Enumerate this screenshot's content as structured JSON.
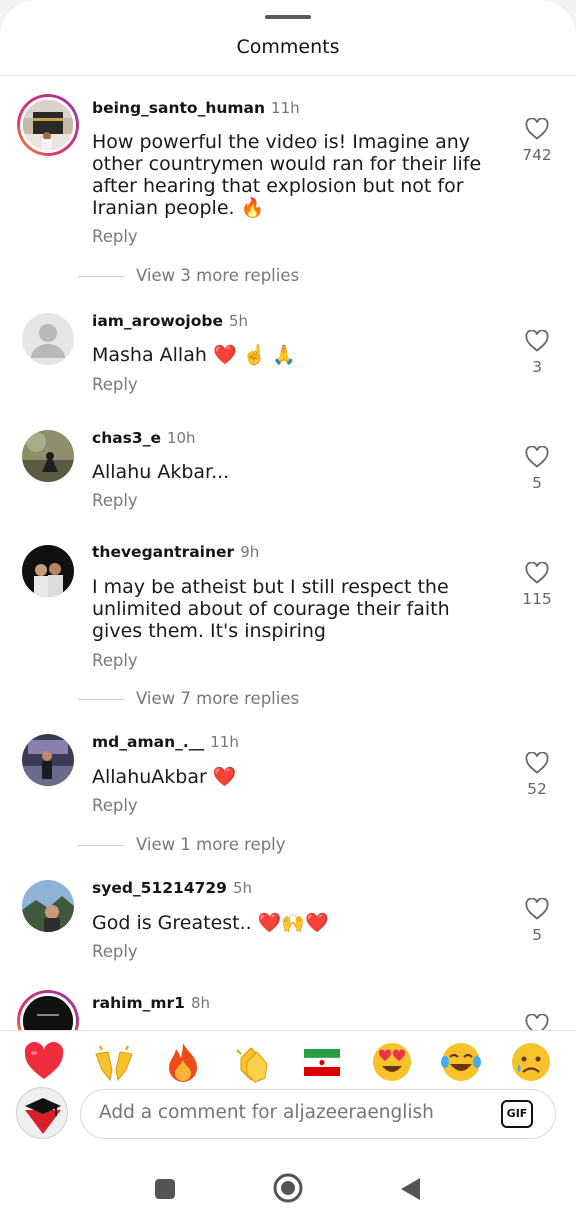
{
  "sheet": {
    "title": "Comments"
  },
  "comments": [
    {
      "username": "being_santo_human",
      "time": "11h",
      "text": "How powerful the video is! Imagine any other countrymen would ran for their life after hearing that explosion but not for Iranian people. 🔥",
      "reply_label": "Reply",
      "likes": "742",
      "more_replies": "View 3 more replies"
    },
    {
      "username": "iam_arowojobe",
      "time": "5h",
      "text": "Masha Allah ❤️ ☝️ 🙏",
      "reply_label": "Reply",
      "likes": "3"
    },
    {
      "username": "chas3_e",
      "time": "10h",
      "text": "Allahu Akbar...",
      "reply_label": "Reply",
      "likes": "5"
    },
    {
      "username": "thevegantrainer",
      "time": "9h",
      "text": "I may be atheist but I still respect the unlimited about of courage their faith gives them.  It's inspiring",
      "reply_label": "Reply",
      "likes": "115",
      "more_replies": "View 7 more replies"
    },
    {
      "username": "md_aman_.__",
      "time": "11h",
      "text": "AllahuAkbar ❤️",
      "reply_label": "Reply",
      "likes": "52",
      "more_replies": "View 1 more reply"
    },
    {
      "username": "syed_51214729",
      "time": "5h",
      "text": "God is Greatest.. ❤️🙌❤️",
      "reply_label": "Reply",
      "likes": "5"
    },
    {
      "username": "rahim_mr1",
      "time": "8h"
    }
  ],
  "emoji_bar": [
    "heart",
    "raising-hands",
    "fire",
    "clapping-hands",
    "iran-flag",
    "heart-eyes",
    "tears-of-joy",
    "sad-tear"
  ],
  "composer": {
    "placeholder": "Add a comment for aljazeeraenglish",
    "gif_label": "GIF"
  },
  "colors": {
    "background": "#ffffff",
    "text": "#1a1a1a",
    "muted": "#777777",
    "heart": "#ee2c3c"
  }
}
